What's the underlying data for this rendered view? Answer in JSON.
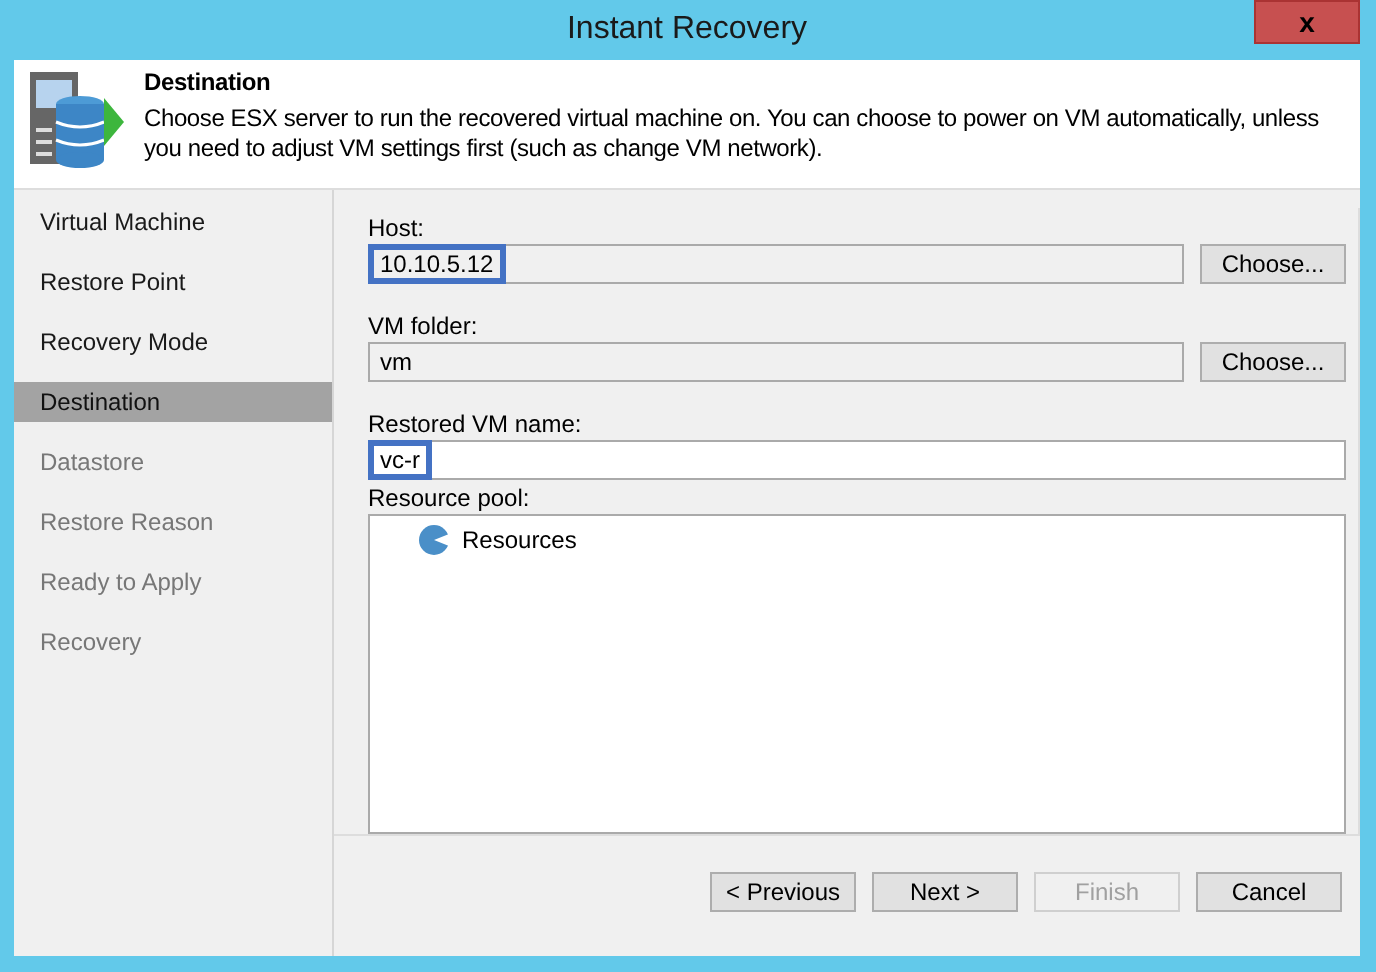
{
  "window": {
    "title": "Instant Recovery",
    "close": "x"
  },
  "header": {
    "title": "Destination",
    "description": "Choose ESX server to run the recovered virtual machine on. You can choose to power on VM automatically, unless you need to adjust VM settings first (such as change VM network)."
  },
  "steps": [
    {
      "label": "Virtual Machine",
      "selected": false,
      "disabled": false
    },
    {
      "label": "Restore Point",
      "selected": false,
      "disabled": false
    },
    {
      "label": "Recovery Mode",
      "selected": false,
      "disabled": false
    },
    {
      "label": "Destination",
      "selected": true,
      "disabled": false
    },
    {
      "label": "Datastore",
      "selected": false,
      "disabled": true
    },
    {
      "label": "Restore Reason",
      "selected": false,
      "disabled": true
    },
    {
      "label": "Ready to Apply",
      "selected": false,
      "disabled": true
    },
    {
      "label": "Recovery",
      "selected": false,
      "disabled": true
    }
  ],
  "fields": [
    {
      "label": "Host:",
      "value": "10.10.5.12",
      "readonly": true,
      "highlighted": true,
      "button": "Choose..."
    },
    {
      "label": "VM folder:",
      "value": "vm",
      "readonly": true,
      "highlighted": false,
      "button": "Choose..."
    },
    {
      "label": "Restored VM name:",
      "value": "vc-r",
      "readonly": false,
      "highlighted": true
    }
  ],
  "resource_pool": {
    "label": "Resource pool:",
    "items": [
      {
        "label": "Resources"
      }
    ]
  },
  "buttons": [
    {
      "label": "< Previous",
      "disabled": false
    },
    {
      "label": "Next >",
      "disabled": false
    },
    {
      "label": "Finish",
      "disabled": true
    },
    {
      "label": "Cancel",
      "disabled": false
    }
  ]
}
